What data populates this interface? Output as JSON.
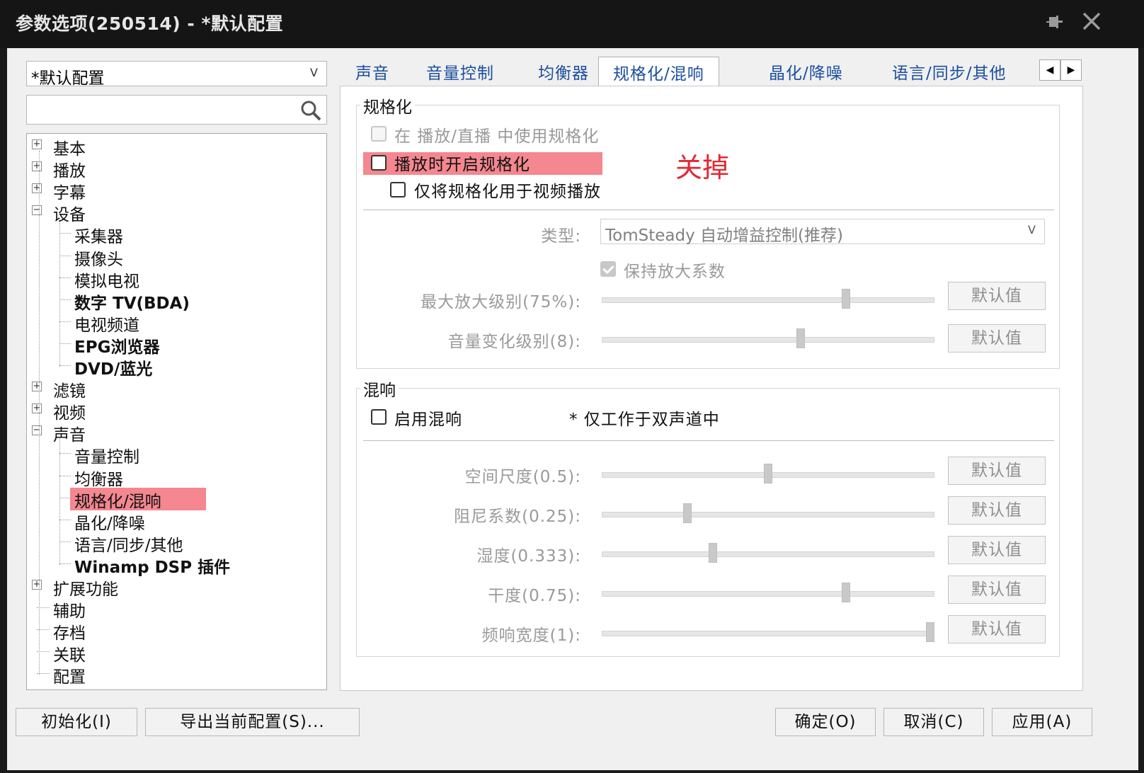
{
  "window": {
    "title": "参数选项(250514) - *默认配置"
  },
  "left": {
    "profile": "*默认配置",
    "search_placeholder": "",
    "tree": [
      {
        "label": "基本",
        "level": 0,
        "expander": "+"
      },
      {
        "label": "播放",
        "level": 0,
        "expander": "+"
      },
      {
        "label": "字幕",
        "level": 0,
        "expander": "+"
      },
      {
        "label": "设备",
        "level": 0,
        "expander": "−"
      },
      {
        "label": "采集器",
        "level": 1,
        "expander": ""
      },
      {
        "label": "摄像头",
        "level": 1,
        "expander": ""
      },
      {
        "label": "模拟电视",
        "level": 1,
        "expander": ""
      },
      {
        "label": "数字 TV(BDA)",
        "level": 1,
        "expander": ""
      },
      {
        "label": "电视频道",
        "level": 1,
        "expander": ""
      },
      {
        "label": "EPG浏览器",
        "level": 1,
        "expander": ""
      },
      {
        "label": "DVD/蓝光",
        "level": 1,
        "expander": ""
      },
      {
        "label": "滤镜",
        "level": 0,
        "expander": "+"
      },
      {
        "label": "视频",
        "level": 0,
        "expander": "+"
      },
      {
        "label": "声音",
        "level": 0,
        "expander": "−"
      },
      {
        "label": "音量控制",
        "level": 1,
        "expander": ""
      },
      {
        "label": "均衡器",
        "level": 1,
        "expander": ""
      },
      {
        "label": "规格化/混响",
        "level": 1,
        "expander": "",
        "selected": true
      },
      {
        "label": "晶化/降噪",
        "level": 1,
        "expander": ""
      },
      {
        "label": "语言/同步/其他",
        "level": 1,
        "expander": ""
      },
      {
        "label": "Winamp DSP 插件",
        "level": 1,
        "expander": ""
      },
      {
        "label": "扩展功能",
        "level": 0,
        "expander": "+"
      },
      {
        "label": "辅助",
        "level": 0,
        "expander": ""
      },
      {
        "label": "存档",
        "level": 0,
        "expander": ""
      },
      {
        "label": "关联",
        "level": 0,
        "expander": ""
      },
      {
        "label": "配置",
        "level": 0,
        "expander": ""
      }
    ]
  },
  "tabs": [
    "声音",
    "音量控制",
    "均衡器",
    "规格化/混响",
    "晶化/降噪",
    "语言/同步/其他"
  ],
  "active_tab": "规格化/混响",
  "normalize": {
    "group_title": "规格化",
    "use_in_playback_live": "在 播放/直播 中使用规格化",
    "enable_on_play": "播放时开启规格化",
    "video_only": "仅将规格化用于视频播放",
    "type_label": "类型:",
    "type_value": "TomSteady 自动增益控制(推荐)",
    "keep_gain": "保持放大系数",
    "max_gain_label": "最大放大级别(75%):",
    "max_gain_value": 0.74,
    "volume_change_label": "音量变化级别(8):",
    "volume_change_value": 0.6,
    "default_btn": "默认值"
  },
  "annotation": "关掉",
  "reverb": {
    "group_title": "混响",
    "enable": "启用混响",
    "note": "* 仅工作于双声道中",
    "sliders": [
      {
        "label": "空间尺度(0.5):",
        "value": 0.5
      },
      {
        "label": "阻尼系数(0.25):",
        "value": 0.25
      },
      {
        "label": "湿度(0.333):",
        "value": 0.33
      },
      {
        "label": "干度(0.75):",
        "value": 0.74
      },
      {
        "label": "频响宽度(1):",
        "value": 1.0
      }
    ],
    "default_btn": "默认值"
  },
  "bottom": {
    "init": "初始化(I)",
    "export": "导出当前配置(S)...",
    "ok": "确定(O)",
    "cancel": "取消(C)",
    "apply": "应用(A)"
  }
}
